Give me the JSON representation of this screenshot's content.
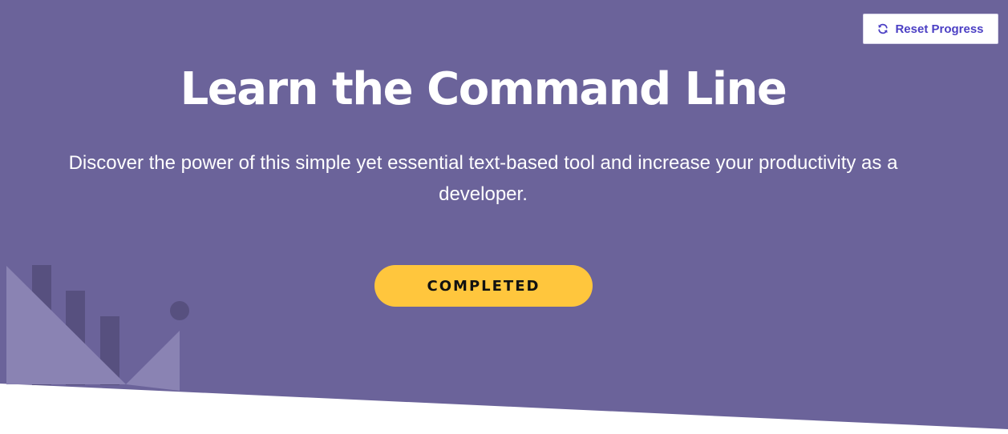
{
  "hero": {
    "title": "Learn the Command Line",
    "subtitle": "Discover the power of this simple yet essential text-based tool and increase your productivity as a developer.",
    "status_button_label": "COMPLETED",
    "background_color": "#6b639a"
  },
  "header": {
    "reset_button_label": "Reset Progress",
    "reset_icon": "refresh-icon"
  },
  "colors": {
    "accent_yellow": "#ffc63d",
    "link_purple": "#4b3fc4",
    "white": "#ffffff"
  }
}
